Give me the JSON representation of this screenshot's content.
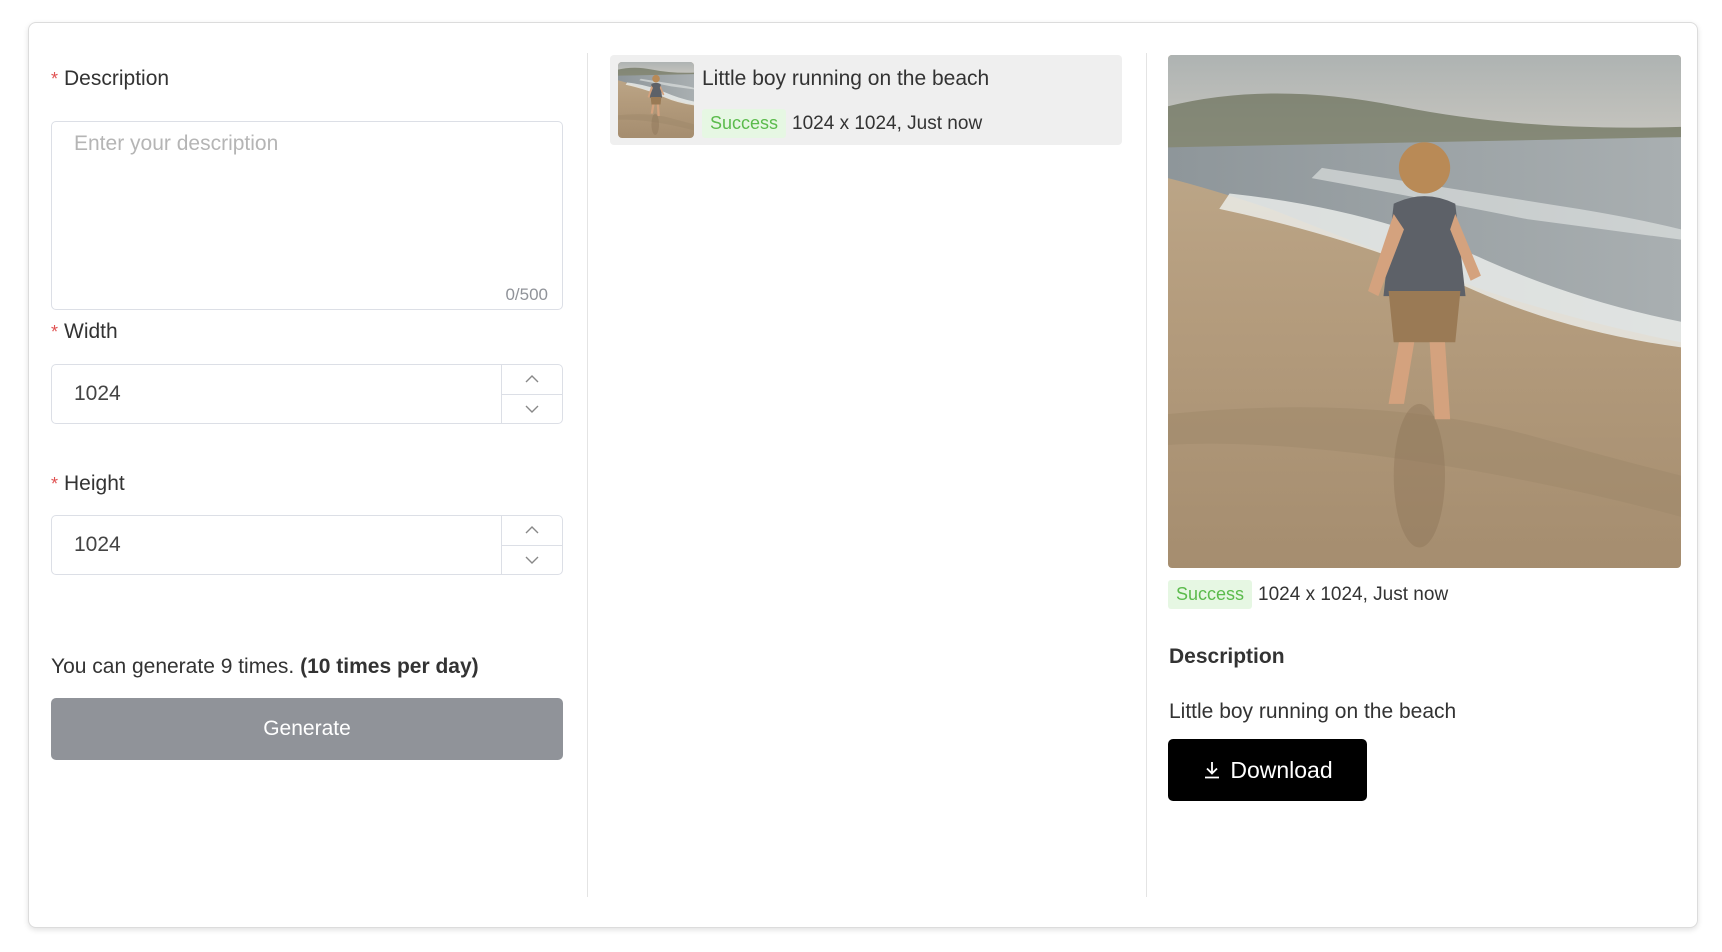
{
  "form": {
    "description_label": "Description",
    "description_placeholder": "Enter your description",
    "description_value": "",
    "char_counter": "0/500",
    "width_label": "Width",
    "width_value": "1024",
    "height_label": "Height",
    "height_value": "1024",
    "required_mark": "*",
    "quota_text": "You can generate 9 times.",
    "quota_limit": "(10 times per day)",
    "generate_label": "Generate"
  },
  "history": {
    "items": [
      {
        "title": "Little boy running on the beach",
        "status": "Success",
        "meta": "1024 x 1024, Just now"
      }
    ]
  },
  "preview": {
    "status": "Success",
    "meta": "1024 x 1024, Just now",
    "description_heading": "Description",
    "description_text": "Little boy running on the beach",
    "download_label": "Download"
  },
  "colors": {
    "success_text": "#5bbb4c",
    "success_bg": "#e6f7e3",
    "required": "#e05252",
    "generate_bg": "#909399",
    "download_bg": "#000000"
  },
  "icons": {
    "stepper_up": "chevron-up-icon",
    "stepper_down": "chevron-down-icon",
    "download": "download-icon"
  }
}
